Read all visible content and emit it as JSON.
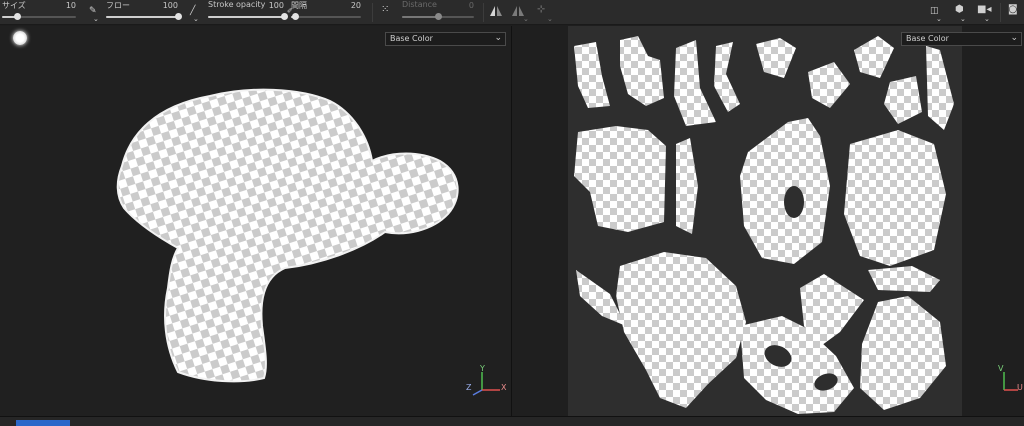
{
  "toolbar": {
    "size": {
      "label": "サイズ",
      "value": "10",
      "level": 0.2
    },
    "flow": {
      "label": "フロー",
      "value": "100",
      "level": 1.0
    },
    "stroke_opacity": {
      "label": "Stroke opacity",
      "value": "100",
      "level": 1.0
    },
    "spacing": {
      "label": "間隔",
      "value": "20",
      "level": 0.05
    },
    "distance": {
      "label": "Distance",
      "value": "0",
      "level": 0.5,
      "disabled": true
    }
  },
  "viewport3d": {
    "channel_select": "Base Color",
    "axes": {
      "y": "Y",
      "z": "Z",
      "x": "X"
    }
  },
  "viewport2d": {
    "channel_select": "Base Color",
    "axes": {
      "v": "V",
      "u": "U"
    }
  },
  "icons": {
    "light": "environment-light-icon",
    "brush_tip": "brush-tip-icon",
    "pen": "pen-icon",
    "lazy_mouse": "lazy-mouse-icon",
    "symmetry": "symmetry-icon",
    "symmetry_options": "symmetry-options-icon",
    "view_settings": "view-settings-icon",
    "display_cube": "display-cube-icon",
    "camera": "camera-icon",
    "screenshot": "screenshot-icon"
  },
  "colors": {
    "panel": "#2b2b2b",
    "viewport": "#202020",
    "uv_sheet": "#2e2e2e",
    "checker_light": "#ffffff",
    "checker_dark": "#cccccc",
    "accent": "#2a67c9"
  }
}
